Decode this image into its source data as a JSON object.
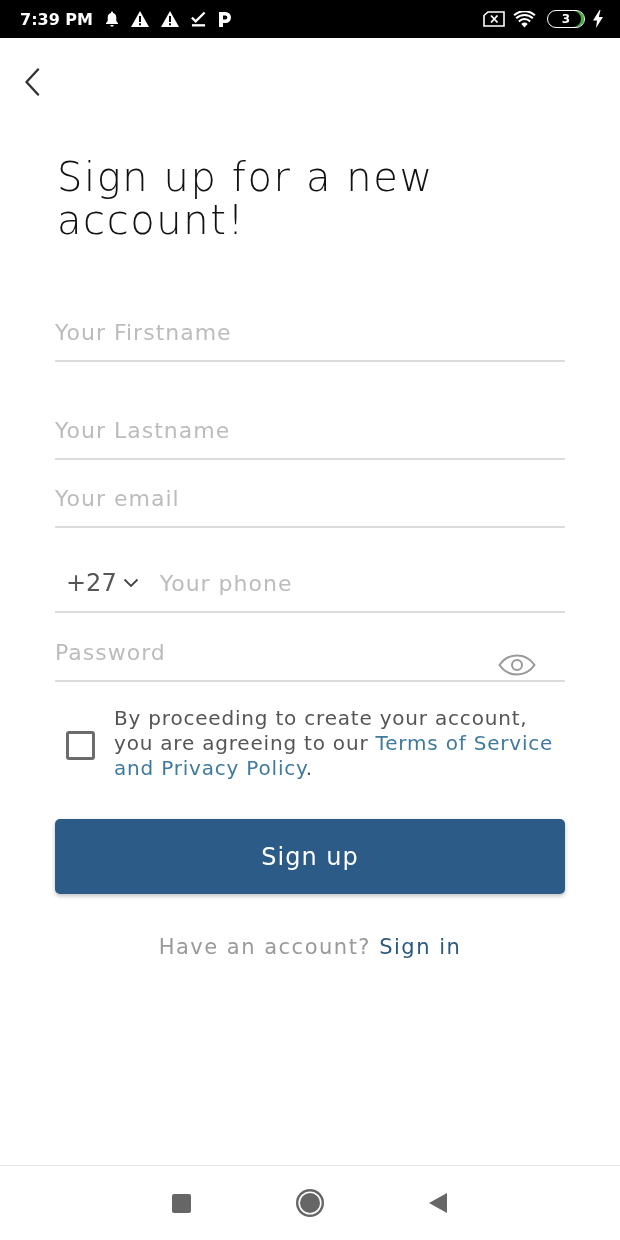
{
  "status_bar": {
    "time": "7:39 PM",
    "battery": "3"
  },
  "title": "Sign up for a new account!",
  "fields": [
    {
      "kind": "text",
      "placeholder": "Your Firstname"
    },
    {
      "kind": "text",
      "placeholder": "Your Lastname"
    },
    {
      "kind": "email",
      "placeholder": "Your email"
    },
    {
      "kind": "phone",
      "country_code": "+27",
      "placeholder": "Your phone"
    },
    {
      "kind": "password",
      "placeholder": "Password"
    }
  ],
  "consent": {
    "checked": false,
    "text": "By proceeding to create your account, you are agreeing to our",
    "links": [
      "Terms of Service",
      "and Privacy Policy"
    ],
    "suffix": "."
  },
  "signup_button": "Sign up",
  "signin_prompt": {
    "text": "Have an account?",
    "link": "Sign in"
  }
}
